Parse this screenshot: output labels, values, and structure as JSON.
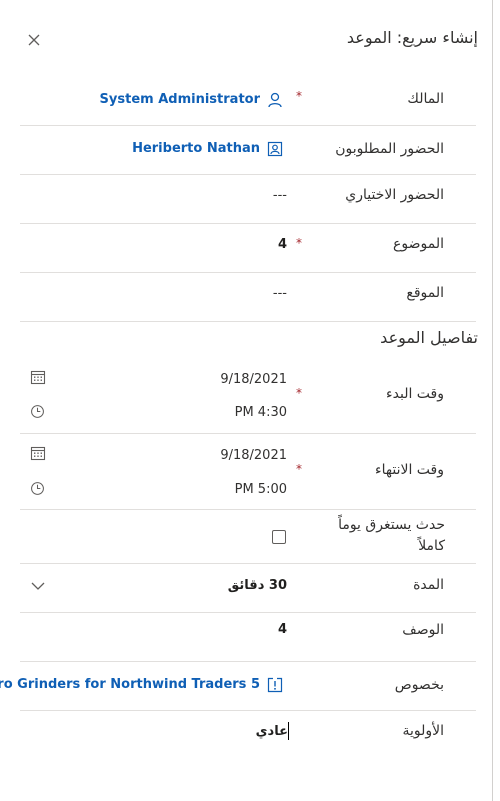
{
  "header": {
    "title": "إنشاء سريع: الموعد",
    "close_icon": "close-icon"
  },
  "fields": {
    "owner": {
      "label": "المالك",
      "required": "*",
      "value": "System Administrator",
      "icon": "person-icon"
    },
    "required_attendees": {
      "label": "الحضور المطلوبون",
      "value": "Heriberto Nathan",
      "icon": "contact-card-icon"
    },
    "optional_attendees": {
      "label": "الحضور الاختياري",
      "value": "---"
    },
    "subject": {
      "label": "الموضوع",
      "required": "*",
      "value": "4"
    },
    "location": {
      "label": "الموقع",
      "value": "---"
    }
  },
  "section": {
    "title": "تفاصيل الموعد"
  },
  "details": {
    "start": {
      "label": "وقت البدء",
      "required": "*",
      "date": "9/18/2021",
      "time": "PM 4:30",
      "date_icon": "calendar-icon",
      "time_icon": "clock-icon"
    },
    "end": {
      "label": "وقت الانتهاء",
      "required": "*",
      "date": "9/18/2021",
      "time": "PM 5:00",
      "date_icon": "calendar-icon",
      "time_icon": "clock-icon"
    },
    "all_day": {
      "label_line1": "حدث يستغرق يوماً",
      "label_line2": "كاملاً",
      "checked": false
    },
    "duration": {
      "label": "المدة",
      "value": "30 دقائق",
      "icon": "chevron-down-icon"
    },
    "description": {
      "label": "الوصف",
      "value": "4"
    },
    "regarding": {
      "label": "بخصوص",
      "value": "...ro Grinders for Northwind Traders 5",
      "icon": "opportunity-icon"
    },
    "priority": {
      "label": "الأولوية",
      "value": "عادي"
    }
  }
}
